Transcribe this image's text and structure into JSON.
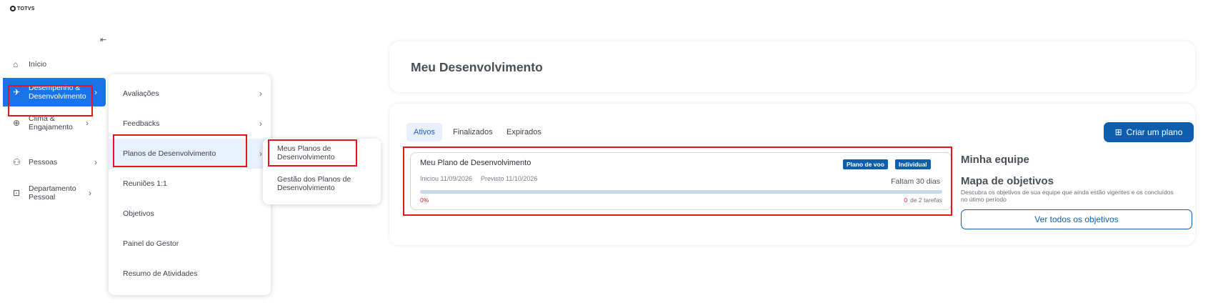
{
  "brand": {
    "name": "TOTVS"
  },
  "sidebar": {
    "collapse_glyph": "⇤",
    "items": [
      {
        "icon": "home-icon",
        "glyph": "⌂",
        "label": "Início",
        "has_submenu": false
      },
      {
        "icon": "rocket-icon",
        "glyph": "✈",
        "label": "Desempenho & Desenvolvimento",
        "has_submenu": true,
        "active": true
      },
      {
        "icon": "search-chart-icon",
        "glyph": "⊕",
        "label": "Clima & Engajamento",
        "has_submenu": true
      },
      {
        "icon": "people-icon",
        "glyph": "⚇",
        "label": "Pessoas",
        "has_submenu": true
      },
      {
        "icon": "badge-icon",
        "glyph": "⊡",
        "label": "Departamento Pessoal",
        "has_submenu": true
      }
    ]
  },
  "submenu": {
    "items": [
      {
        "label": "Avaliações",
        "has_submenu": true
      },
      {
        "label": "Feedbacks",
        "has_submenu": true
      },
      {
        "label": "Planos de Desenvolvimento",
        "has_submenu": true,
        "highlighted": true
      },
      {
        "label": "Reuniões 1:1",
        "has_submenu": false
      },
      {
        "label": "Objetivos",
        "has_submenu": false
      },
      {
        "label": "Painel do Gestor",
        "has_submenu": false
      },
      {
        "label": "Resumo de Atividades",
        "has_submenu": false
      }
    ]
  },
  "submenu2": {
    "items": [
      {
        "label": "Meus Planos de Desenvolvimento"
      },
      {
        "label": "Gestão dos Planos de Desenvolvimento"
      }
    ]
  },
  "main": {
    "title": "Meu Desenvolvimento",
    "tabs": [
      {
        "label": "Ativos",
        "selected": true
      },
      {
        "label": "Finalizados",
        "selected": false
      },
      {
        "label": "Expirados",
        "selected": false
      }
    ],
    "create_button": {
      "label": "Criar um plano",
      "icon": "add-document-icon"
    },
    "plan_card": {
      "title": "Meu Plano de Desenvolvimento",
      "badges": [
        "Plano de voo",
        "Individual"
      ],
      "started": "Iniciou 11/09/2026",
      "expected": "Previsto 11/10/2026",
      "remaining": "Faltam 30 dias",
      "progress": 0,
      "progress_label": "0%",
      "tasks_done": "0",
      "tasks_total_label": "de 2 tarefas"
    },
    "team": {
      "title": "Minha equipe",
      "map_title": "Mapa de objetivos",
      "map_description": "Descubra os objetivos de sua equipe que ainda estão vigentes e os concluídos no útimo período",
      "objectives_button": "Ver todos os objetivos"
    }
  },
  "colors": {
    "accent": "#1a73e8",
    "primary_button": "#0d5fad",
    "highlight_box": "#e8141b",
    "progress_track": "#c9d9eb"
  }
}
